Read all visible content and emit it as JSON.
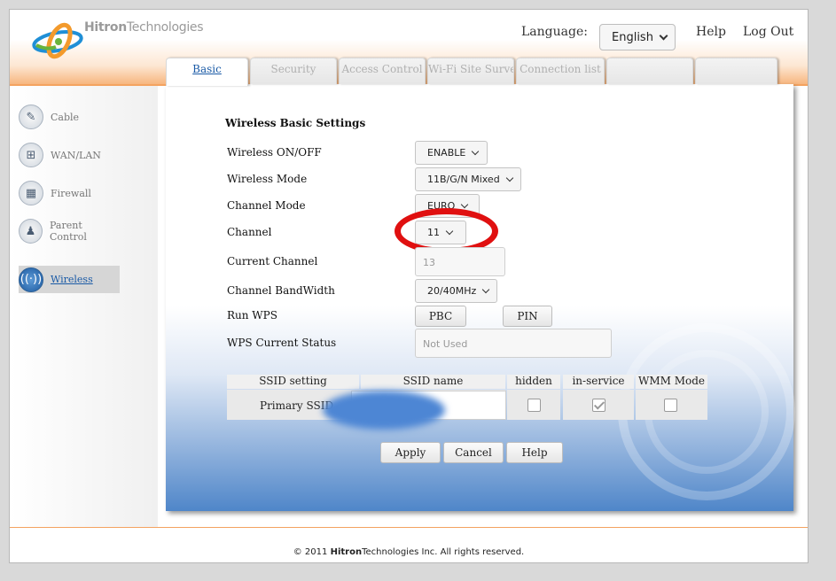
{
  "brand": {
    "part1": "Hitron",
    "part2": "Technologies"
  },
  "header": {
    "language_label": "Language:",
    "language_value": "English",
    "help": "Help",
    "logout": "Log Out"
  },
  "tabs": [
    "Basic",
    "Security",
    "Access Control",
    "Wi-Fi Site Survey",
    "Connection list",
    "",
    ""
  ],
  "sidebar": [
    {
      "label": "Cable",
      "icon": "wrench-icon"
    },
    {
      "label": "WAN/LAN",
      "icon": "network-icon"
    },
    {
      "label": "Firewall",
      "icon": "firewall-icon"
    },
    {
      "label": "Parent Control",
      "icon": "parent-icon"
    },
    {
      "label": "Wireless",
      "icon": "wireless-icon"
    }
  ],
  "form": {
    "title": "Wireless Basic Settings",
    "wireless_onoff": {
      "label": "Wireless ON/OFF",
      "value": "ENABLE"
    },
    "wireless_mode": {
      "label": "Wireless Mode",
      "value": "11B/G/N Mixed"
    },
    "channel_mode": {
      "label": "Channel Mode",
      "value": "EURO"
    },
    "channel": {
      "label": "Channel",
      "value": "11"
    },
    "current_channel": {
      "label": "Current Channel",
      "value": "13"
    },
    "bandwidth": {
      "label": "Channel BandWidth",
      "value": "20/40MHz"
    },
    "wps": {
      "label": "Run WPS",
      "pbc": "PBC",
      "pin": "PIN"
    },
    "wps_status": {
      "label": "WPS Current Status",
      "value": "Not Used"
    }
  },
  "ssid_table": {
    "headers": [
      "SSID setting",
      "SSID name",
      "hidden",
      "in-service",
      "WMM Mode"
    ],
    "row": {
      "setting": "Primary SSID",
      "hidden": false,
      "in_service": true,
      "wmm": false
    }
  },
  "buttons": {
    "apply": "Apply",
    "cancel": "Cancel",
    "help": "Help"
  },
  "footer": {
    "prefix": "© 2011",
    "brand1": "Hitron",
    "brand2": "Technologies",
    "suffix": "Inc.  All rights reserved."
  },
  "colors": {
    "accent_orange": "#f4a360",
    "link_blue": "#1a5aa6",
    "highlight_red": "#e01010"
  }
}
